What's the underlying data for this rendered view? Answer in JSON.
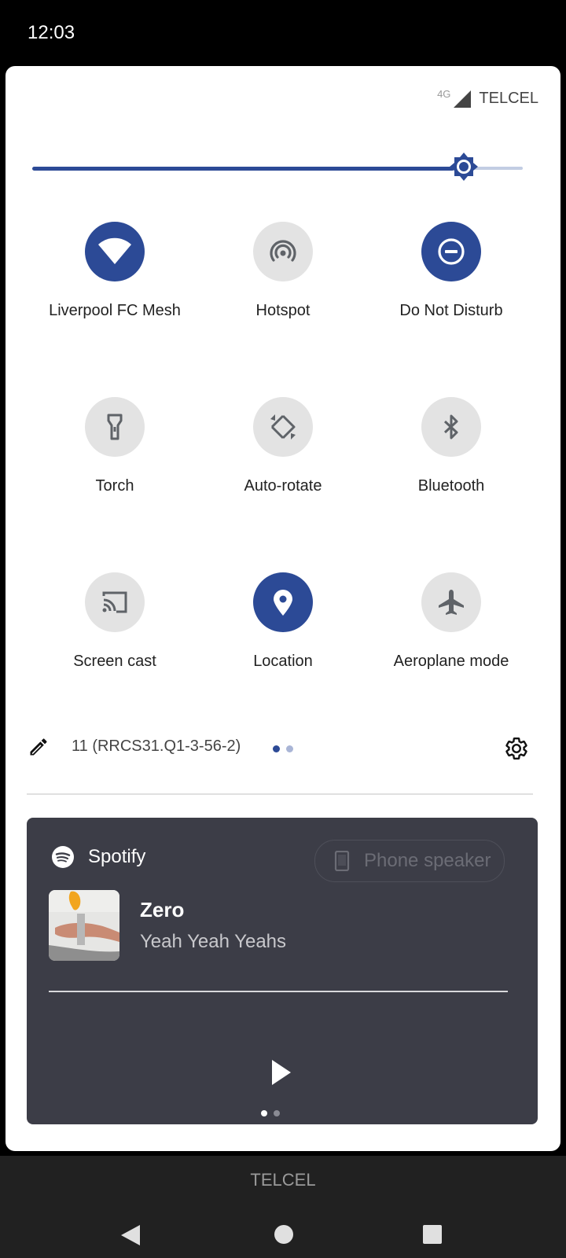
{
  "status_bar": {
    "time": "12:03"
  },
  "network": {
    "type": "4G",
    "carrier": "TELCEL"
  },
  "brightness": {
    "level": 0.88
  },
  "tiles": [
    {
      "label": "Liverpool FC Mesh",
      "icon": "wifi-icon",
      "active": true
    },
    {
      "label": "Hotspot",
      "icon": "hotspot-icon",
      "active": false
    },
    {
      "label": "Do Not Disturb",
      "icon": "do-not-disturb-icon",
      "active": true
    },
    {
      "label": "Torch",
      "icon": "torch-icon",
      "active": false
    },
    {
      "label": "Auto-rotate",
      "icon": "auto-rotate-icon",
      "active": false
    },
    {
      "label": "Bluetooth",
      "icon": "bluetooth-icon",
      "active": false
    },
    {
      "label": "Screen cast",
      "icon": "screen-cast-icon",
      "active": false
    },
    {
      "label": "Location",
      "icon": "location-icon",
      "active": true
    },
    {
      "label": "Aeroplane mode",
      "icon": "airplane-icon",
      "active": false
    }
  ],
  "footer": {
    "build": "11 (RRCS31.Q1-3-56-2)",
    "page_index": 0,
    "page_count": 2
  },
  "media": {
    "app": "Spotify",
    "output": "Phone speaker",
    "title": "Zero",
    "artist": "Yeah Yeah Yeahs",
    "page_index": 0,
    "page_count": 2
  },
  "nav": {
    "carrier": "TELCEL"
  },
  "colors": {
    "accent": "#2c4a96",
    "tile_off": "#e3e3e3",
    "media_bg": "#3c3d47",
    "nav_bg": "#212121"
  }
}
